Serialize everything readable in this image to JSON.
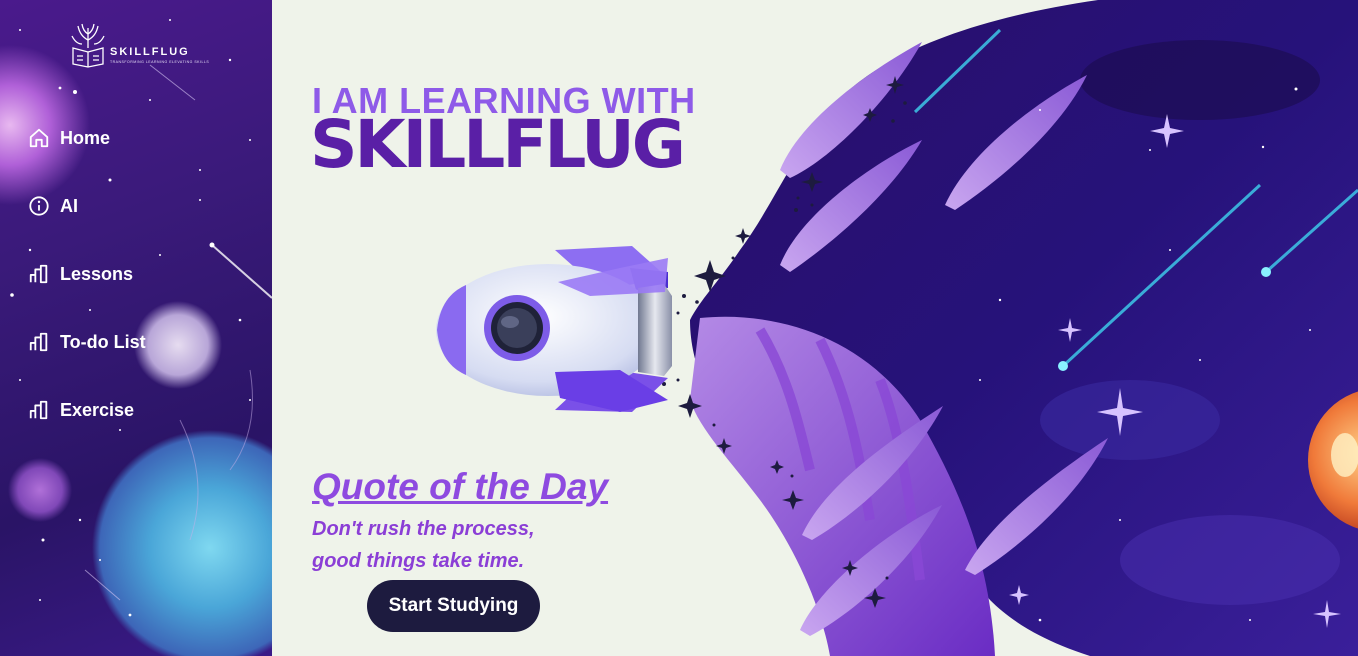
{
  "brand": {
    "name": "SKILLFLUG",
    "tagline": "TRANSFORMING LEARNING ELEVATING SKILLS"
  },
  "sidebar": {
    "items": [
      {
        "label": "Home",
        "icon": "home-icon"
      },
      {
        "label": "AI",
        "icon": "info-icon"
      },
      {
        "label": "Lessons",
        "icon": "bar-chart-icon"
      },
      {
        "label": "To-do List",
        "icon": "bar-chart-icon"
      },
      {
        "label": "Exercise",
        "icon": "bar-chart-icon"
      }
    ]
  },
  "hero": {
    "line1": "I AM LEARNING WITH",
    "line2": "SKILLFLUG"
  },
  "quote": {
    "title": "Quote of the Day",
    "line1": "Don't rush the process,",
    "line2": "good things take time."
  },
  "cta": {
    "label": "Start Studying"
  },
  "colors": {
    "page_bg": "#eff3ea",
    "accent_light": "#8e5ae8",
    "accent_dark": "#5a1fa6",
    "button_bg": "#1d1b3f",
    "space_dark": "#1f0f5c"
  }
}
